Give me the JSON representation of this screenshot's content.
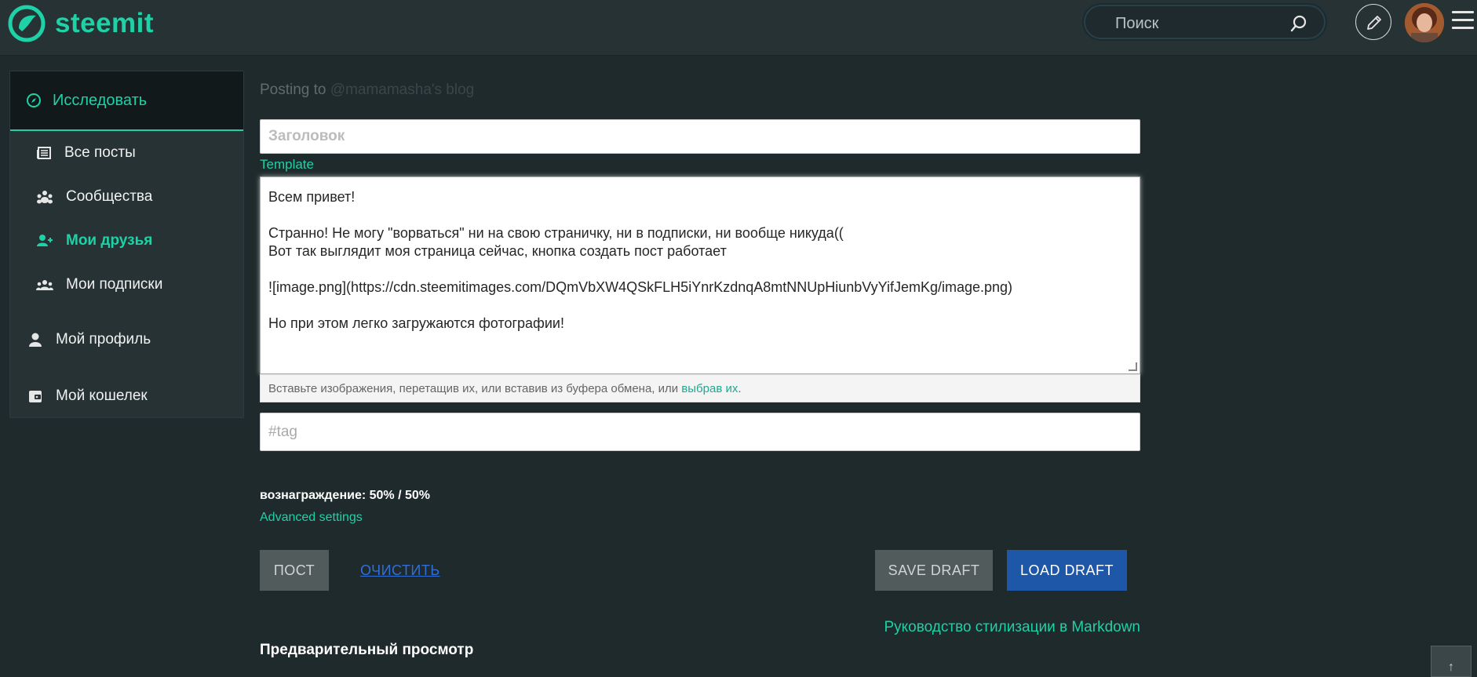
{
  "header": {
    "brand": "steemit",
    "search_placeholder": "Поиск"
  },
  "sidebar": {
    "explore_label": "Исследовать",
    "items": [
      {
        "label": "Все посты",
        "icon": "newspaper-icon"
      },
      {
        "label": "Сообщества",
        "icon": "community-icon"
      },
      {
        "label": "Мои друзья",
        "icon": "user-friends-icon",
        "active": true
      },
      {
        "label": "Мои подписки",
        "icon": "users-icon"
      }
    ],
    "profile_label": "Мой профиль",
    "wallet_label": "Мой кошелек"
  },
  "editor": {
    "posting_prefix": "Posting to",
    "posting_blog": "@mamamasha's blog",
    "title_placeholder": "Заголовок",
    "template_label": "Template",
    "lines": {
      "l1": "Всем привет!",
      "l2": "Странно! Не могу \"ворваться\" ни на свою страничку, ни в подписки, ни вообще никуда((",
      "l3": "Вот так выглядит моя страница сейчас, кнопка создать пост работает",
      "l4": "![image.png](https://cdn.steemitimages.com/DQmVbXW4QSkFLH5iYnrKzdnqA8mtNNUpHiunbVyYifJemKg/image.png)",
      "l5": "Но при этом легко загружаются фотографии!"
    },
    "dropzone_text": "Вставьте изображения, перетащив их, или вставив из буфера обмена, или ",
    "dropzone_link": "выбрав их",
    "dropzone_end": ".",
    "tag_placeholder": "#tag",
    "reward_text": "вознаграждение: 50% / 50%",
    "advanced_label": "Advanced settings",
    "post_button": "ПОСТ",
    "clear_button": "ОЧИСТИТЬ",
    "save_draft_button": "SAVE DRAFT",
    "load_draft_button": "LOAD DRAFT",
    "markdown_link": "Руководство стилизации в Markdown",
    "preview_heading": "Предварительный просмотр"
  },
  "scroll_top_icon": "↑",
  "colors": {
    "accent": "#1fd1a6",
    "background": "#1f2a2c",
    "header": "#263234",
    "load_draft": "#1f57a8"
  }
}
